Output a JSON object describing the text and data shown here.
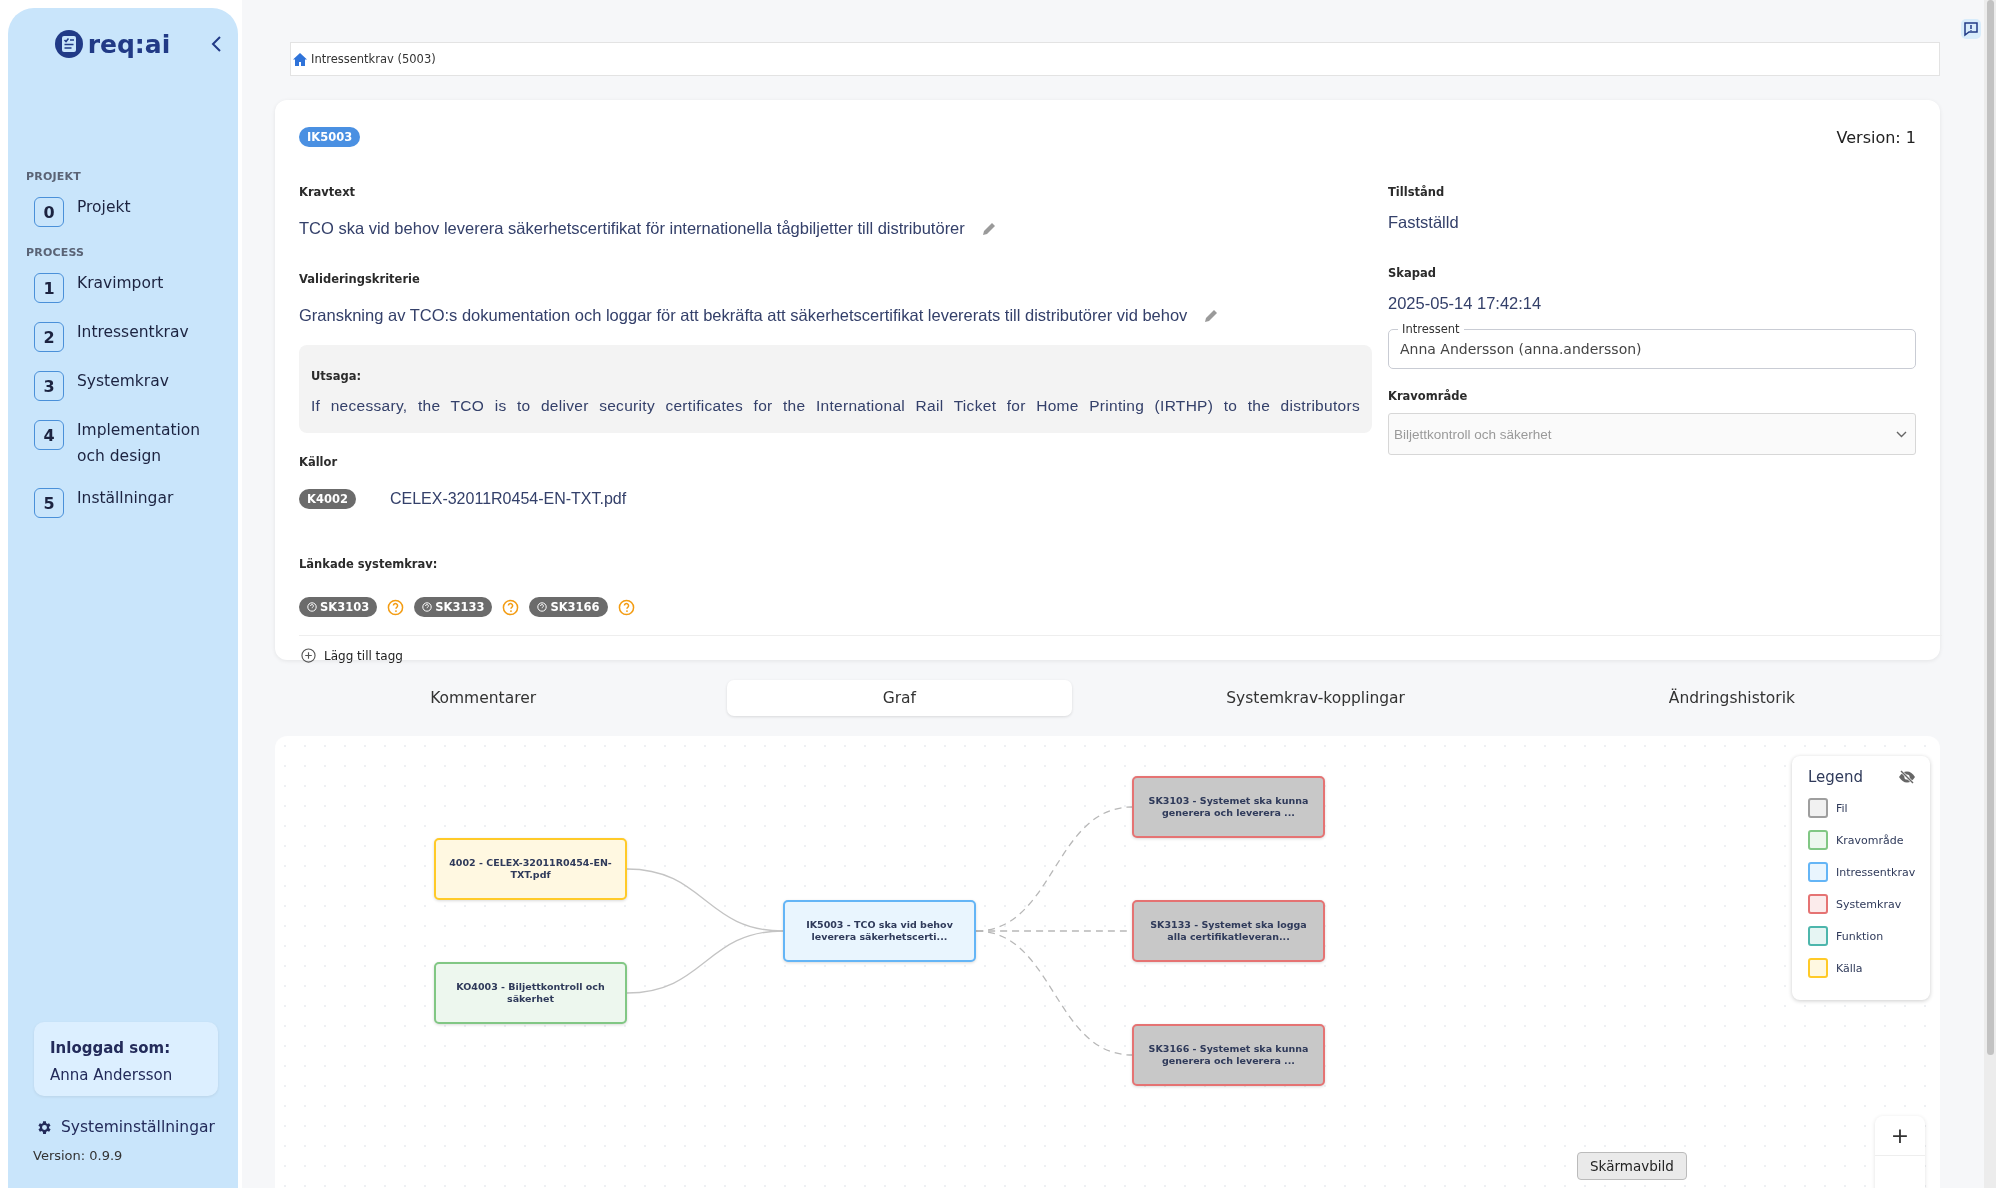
{
  "sidebar": {
    "logo": "req:ai",
    "sections": [
      {
        "title": "PROJEKT",
        "items": [
          {
            "number": "0",
            "label": "Projekt"
          }
        ]
      },
      {
        "title": "PROCESS",
        "items": [
          {
            "number": "1",
            "label": "Kravimport"
          },
          {
            "number": "2",
            "label": "Intressentkrav"
          },
          {
            "number": "3",
            "label": "Systemkrav"
          },
          {
            "number": "4",
            "label": "Implementation och design"
          },
          {
            "number": "5",
            "label": "Inställningar"
          }
        ]
      }
    ],
    "user_card": {
      "label": "Inloggad som:",
      "name": "Anna Andersson"
    },
    "settings_link": "Systeminställningar",
    "version": "Version: 0.9.9"
  },
  "breadcrumb": "Intressentkrav (5003)",
  "requirement": {
    "id_badge": "IK5003",
    "version": "Version: 1",
    "kravtext": {
      "label": "Kravtext",
      "value": "TCO ska vid behov leverera säkerhetscertifikat för internationella tågbiljetter till distributörer"
    },
    "valideringskriterie": {
      "label": "Valideringskriterie",
      "value": "Granskning av TCO:s dokumentation och loggar för att bekräfta att säkerhetscertifikat levererats till distributörer vid behov"
    },
    "utsaga": {
      "label": "Utsaga:",
      "value": "If necessary, the TCO is to deliver security certificates for the International Rail Ticket for Home Printing (IRTHP) to the distributors"
    },
    "kallor": {
      "label": "Källor",
      "items": [
        {
          "badge": "K4002",
          "file": "CELEX-32011R0454-EN-TXT.pdf"
        }
      ]
    },
    "linked": {
      "label": "Länkade systemkrav:",
      "tags": [
        "SK3103",
        "SK3133",
        "SK3166"
      ]
    },
    "add_tag": "Lägg till tagg",
    "tillstand": {
      "label": "Tillstånd",
      "value": "Fastställd"
    },
    "skapad": {
      "label": "Skapad",
      "value": "2025-05-14 17:42:14"
    },
    "intressent": {
      "label": "Intressent",
      "value": "Anna Andersson (anna.andersson)"
    },
    "kravomrade": {
      "label": "Kravområde",
      "value": "Biljettkontroll och säkerhet",
      "disabled": true
    }
  },
  "tabs": [
    {
      "label": "Kommentarer",
      "selected": false
    },
    {
      "label": "Graf",
      "selected": true
    },
    {
      "label": "Systemkrav-kopplingar",
      "selected": false
    },
    {
      "label": "Ändringshistorik",
      "selected": false
    }
  ],
  "graph": {
    "nodes": [
      {
        "kind": "source",
        "text": "4002 - CELEX-32011R0454-EN-TXT.pdf",
        "dimmed": false
      },
      {
        "kind": "area",
        "text": "KO4003 - Biljettkontroll och säkerhet",
        "dimmed": false
      },
      {
        "kind": "stakeholder",
        "text": "IK5003 - TCO ska vid behov leverera säkerhetscerti...",
        "dimmed": false
      },
      {
        "kind": "system",
        "text": "SK3103 - Systemet ska kunna generera och leverera ...",
        "dimmed": true
      },
      {
        "kind": "system",
        "text": "SK3133 - Systemet ska logga alla certifikatleveran...",
        "dimmed": true
      },
      {
        "kind": "system",
        "text": "SK3166 - Systemet ska kunna generera och leverera ...",
        "dimmed": true
      }
    ],
    "legend": {
      "title": "Legend",
      "items": [
        {
          "kind": "file",
          "label": "Fil",
          "color": "#9e9e9e"
        },
        {
          "kind": "area",
          "label": "Kravområde",
          "color": "#81c784"
        },
        {
          "kind": "stakeholder",
          "label": "Intressentkrav",
          "color": "#64b5f6"
        },
        {
          "kind": "system",
          "label": "Systemkrav",
          "color": "#e57373"
        },
        {
          "kind": "function",
          "label": "Funktion",
          "color": "#4db6ac"
        },
        {
          "kind": "source",
          "label": "Källa",
          "color": "#ffca28"
        }
      ]
    },
    "zoom_in": "+"
  },
  "tooltip": "Skärmavbild"
}
